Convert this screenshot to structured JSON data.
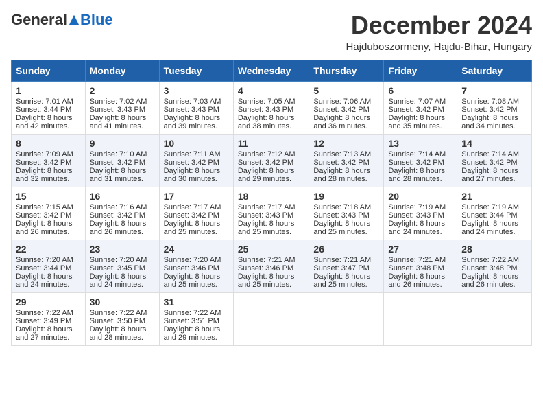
{
  "logo": {
    "general": "General",
    "blue": "Blue"
  },
  "title": {
    "month_year": "December 2024",
    "location": "Hajduboszormeny, Hajdu-Bihar, Hungary"
  },
  "headers": [
    "Sunday",
    "Monday",
    "Tuesday",
    "Wednesday",
    "Thursday",
    "Friday",
    "Saturday"
  ],
  "weeks": [
    [
      {
        "day": "1",
        "sunrise": "Sunrise: 7:01 AM",
        "sunset": "Sunset: 3:44 PM",
        "daylight": "Daylight: 8 hours and 42 minutes."
      },
      {
        "day": "2",
        "sunrise": "Sunrise: 7:02 AM",
        "sunset": "Sunset: 3:43 PM",
        "daylight": "Daylight: 8 hours and 41 minutes."
      },
      {
        "day": "3",
        "sunrise": "Sunrise: 7:03 AM",
        "sunset": "Sunset: 3:43 PM",
        "daylight": "Daylight: 8 hours and 39 minutes."
      },
      {
        "day": "4",
        "sunrise": "Sunrise: 7:05 AM",
        "sunset": "Sunset: 3:43 PM",
        "daylight": "Daylight: 8 hours and 38 minutes."
      },
      {
        "day": "5",
        "sunrise": "Sunrise: 7:06 AM",
        "sunset": "Sunset: 3:42 PM",
        "daylight": "Daylight: 8 hours and 36 minutes."
      },
      {
        "day": "6",
        "sunrise": "Sunrise: 7:07 AM",
        "sunset": "Sunset: 3:42 PM",
        "daylight": "Daylight: 8 hours and 35 minutes."
      },
      {
        "day": "7",
        "sunrise": "Sunrise: 7:08 AM",
        "sunset": "Sunset: 3:42 PM",
        "daylight": "Daylight: 8 hours and 34 minutes."
      }
    ],
    [
      {
        "day": "8",
        "sunrise": "Sunrise: 7:09 AM",
        "sunset": "Sunset: 3:42 PM",
        "daylight": "Daylight: 8 hours and 32 minutes."
      },
      {
        "day": "9",
        "sunrise": "Sunrise: 7:10 AM",
        "sunset": "Sunset: 3:42 PM",
        "daylight": "Daylight: 8 hours and 31 minutes."
      },
      {
        "day": "10",
        "sunrise": "Sunrise: 7:11 AM",
        "sunset": "Sunset: 3:42 PM",
        "daylight": "Daylight: 8 hours and 30 minutes."
      },
      {
        "day": "11",
        "sunrise": "Sunrise: 7:12 AM",
        "sunset": "Sunset: 3:42 PM",
        "daylight": "Daylight: 8 hours and 29 minutes."
      },
      {
        "day": "12",
        "sunrise": "Sunrise: 7:13 AM",
        "sunset": "Sunset: 3:42 PM",
        "daylight": "Daylight: 8 hours and 28 minutes."
      },
      {
        "day": "13",
        "sunrise": "Sunrise: 7:14 AM",
        "sunset": "Sunset: 3:42 PM",
        "daylight": "Daylight: 8 hours and 28 minutes."
      },
      {
        "day": "14",
        "sunrise": "Sunrise: 7:14 AM",
        "sunset": "Sunset: 3:42 PM",
        "daylight": "Daylight: 8 hours and 27 minutes."
      }
    ],
    [
      {
        "day": "15",
        "sunrise": "Sunrise: 7:15 AM",
        "sunset": "Sunset: 3:42 PM",
        "daylight": "Daylight: 8 hours and 26 minutes."
      },
      {
        "day": "16",
        "sunrise": "Sunrise: 7:16 AM",
        "sunset": "Sunset: 3:42 PM",
        "daylight": "Daylight: 8 hours and 26 minutes."
      },
      {
        "day": "17",
        "sunrise": "Sunrise: 7:17 AM",
        "sunset": "Sunset: 3:42 PM",
        "daylight": "Daylight: 8 hours and 25 minutes."
      },
      {
        "day": "18",
        "sunrise": "Sunrise: 7:17 AM",
        "sunset": "Sunset: 3:43 PM",
        "daylight": "Daylight: 8 hours and 25 minutes."
      },
      {
        "day": "19",
        "sunrise": "Sunrise: 7:18 AM",
        "sunset": "Sunset: 3:43 PM",
        "daylight": "Daylight: 8 hours and 25 minutes."
      },
      {
        "day": "20",
        "sunrise": "Sunrise: 7:19 AM",
        "sunset": "Sunset: 3:43 PM",
        "daylight": "Daylight: 8 hours and 24 minutes."
      },
      {
        "day": "21",
        "sunrise": "Sunrise: 7:19 AM",
        "sunset": "Sunset: 3:44 PM",
        "daylight": "Daylight: 8 hours and 24 minutes."
      }
    ],
    [
      {
        "day": "22",
        "sunrise": "Sunrise: 7:20 AM",
        "sunset": "Sunset: 3:44 PM",
        "daylight": "Daylight: 8 hours and 24 minutes."
      },
      {
        "day": "23",
        "sunrise": "Sunrise: 7:20 AM",
        "sunset": "Sunset: 3:45 PM",
        "daylight": "Daylight: 8 hours and 24 minutes."
      },
      {
        "day": "24",
        "sunrise": "Sunrise: 7:20 AM",
        "sunset": "Sunset: 3:46 PM",
        "daylight": "Daylight: 8 hours and 25 minutes."
      },
      {
        "day": "25",
        "sunrise": "Sunrise: 7:21 AM",
        "sunset": "Sunset: 3:46 PM",
        "daylight": "Daylight: 8 hours and 25 minutes."
      },
      {
        "day": "26",
        "sunrise": "Sunrise: 7:21 AM",
        "sunset": "Sunset: 3:47 PM",
        "daylight": "Daylight: 8 hours and 25 minutes."
      },
      {
        "day": "27",
        "sunrise": "Sunrise: 7:21 AM",
        "sunset": "Sunset: 3:48 PM",
        "daylight": "Daylight: 8 hours and 26 minutes."
      },
      {
        "day": "28",
        "sunrise": "Sunrise: 7:22 AM",
        "sunset": "Sunset: 3:48 PM",
        "daylight": "Daylight: 8 hours and 26 minutes."
      }
    ],
    [
      {
        "day": "29",
        "sunrise": "Sunrise: 7:22 AM",
        "sunset": "Sunset: 3:49 PM",
        "daylight": "Daylight: 8 hours and 27 minutes."
      },
      {
        "day": "30",
        "sunrise": "Sunrise: 7:22 AM",
        "sunset": "Sunset: 3:50 PM",
        "daylight": "Daylight: 8 hours and 28 minutes."
      },
      {
        "day": "31",
        "sunrise": "Sunrise: 7:22 AM",
        "sunset": "Sunset: 3:51 PM",
        "daylight": "Daylight: 8 hours and 29 minutes."
      },
      null,
      null,
      null,
      null
    ]
  ]
}
